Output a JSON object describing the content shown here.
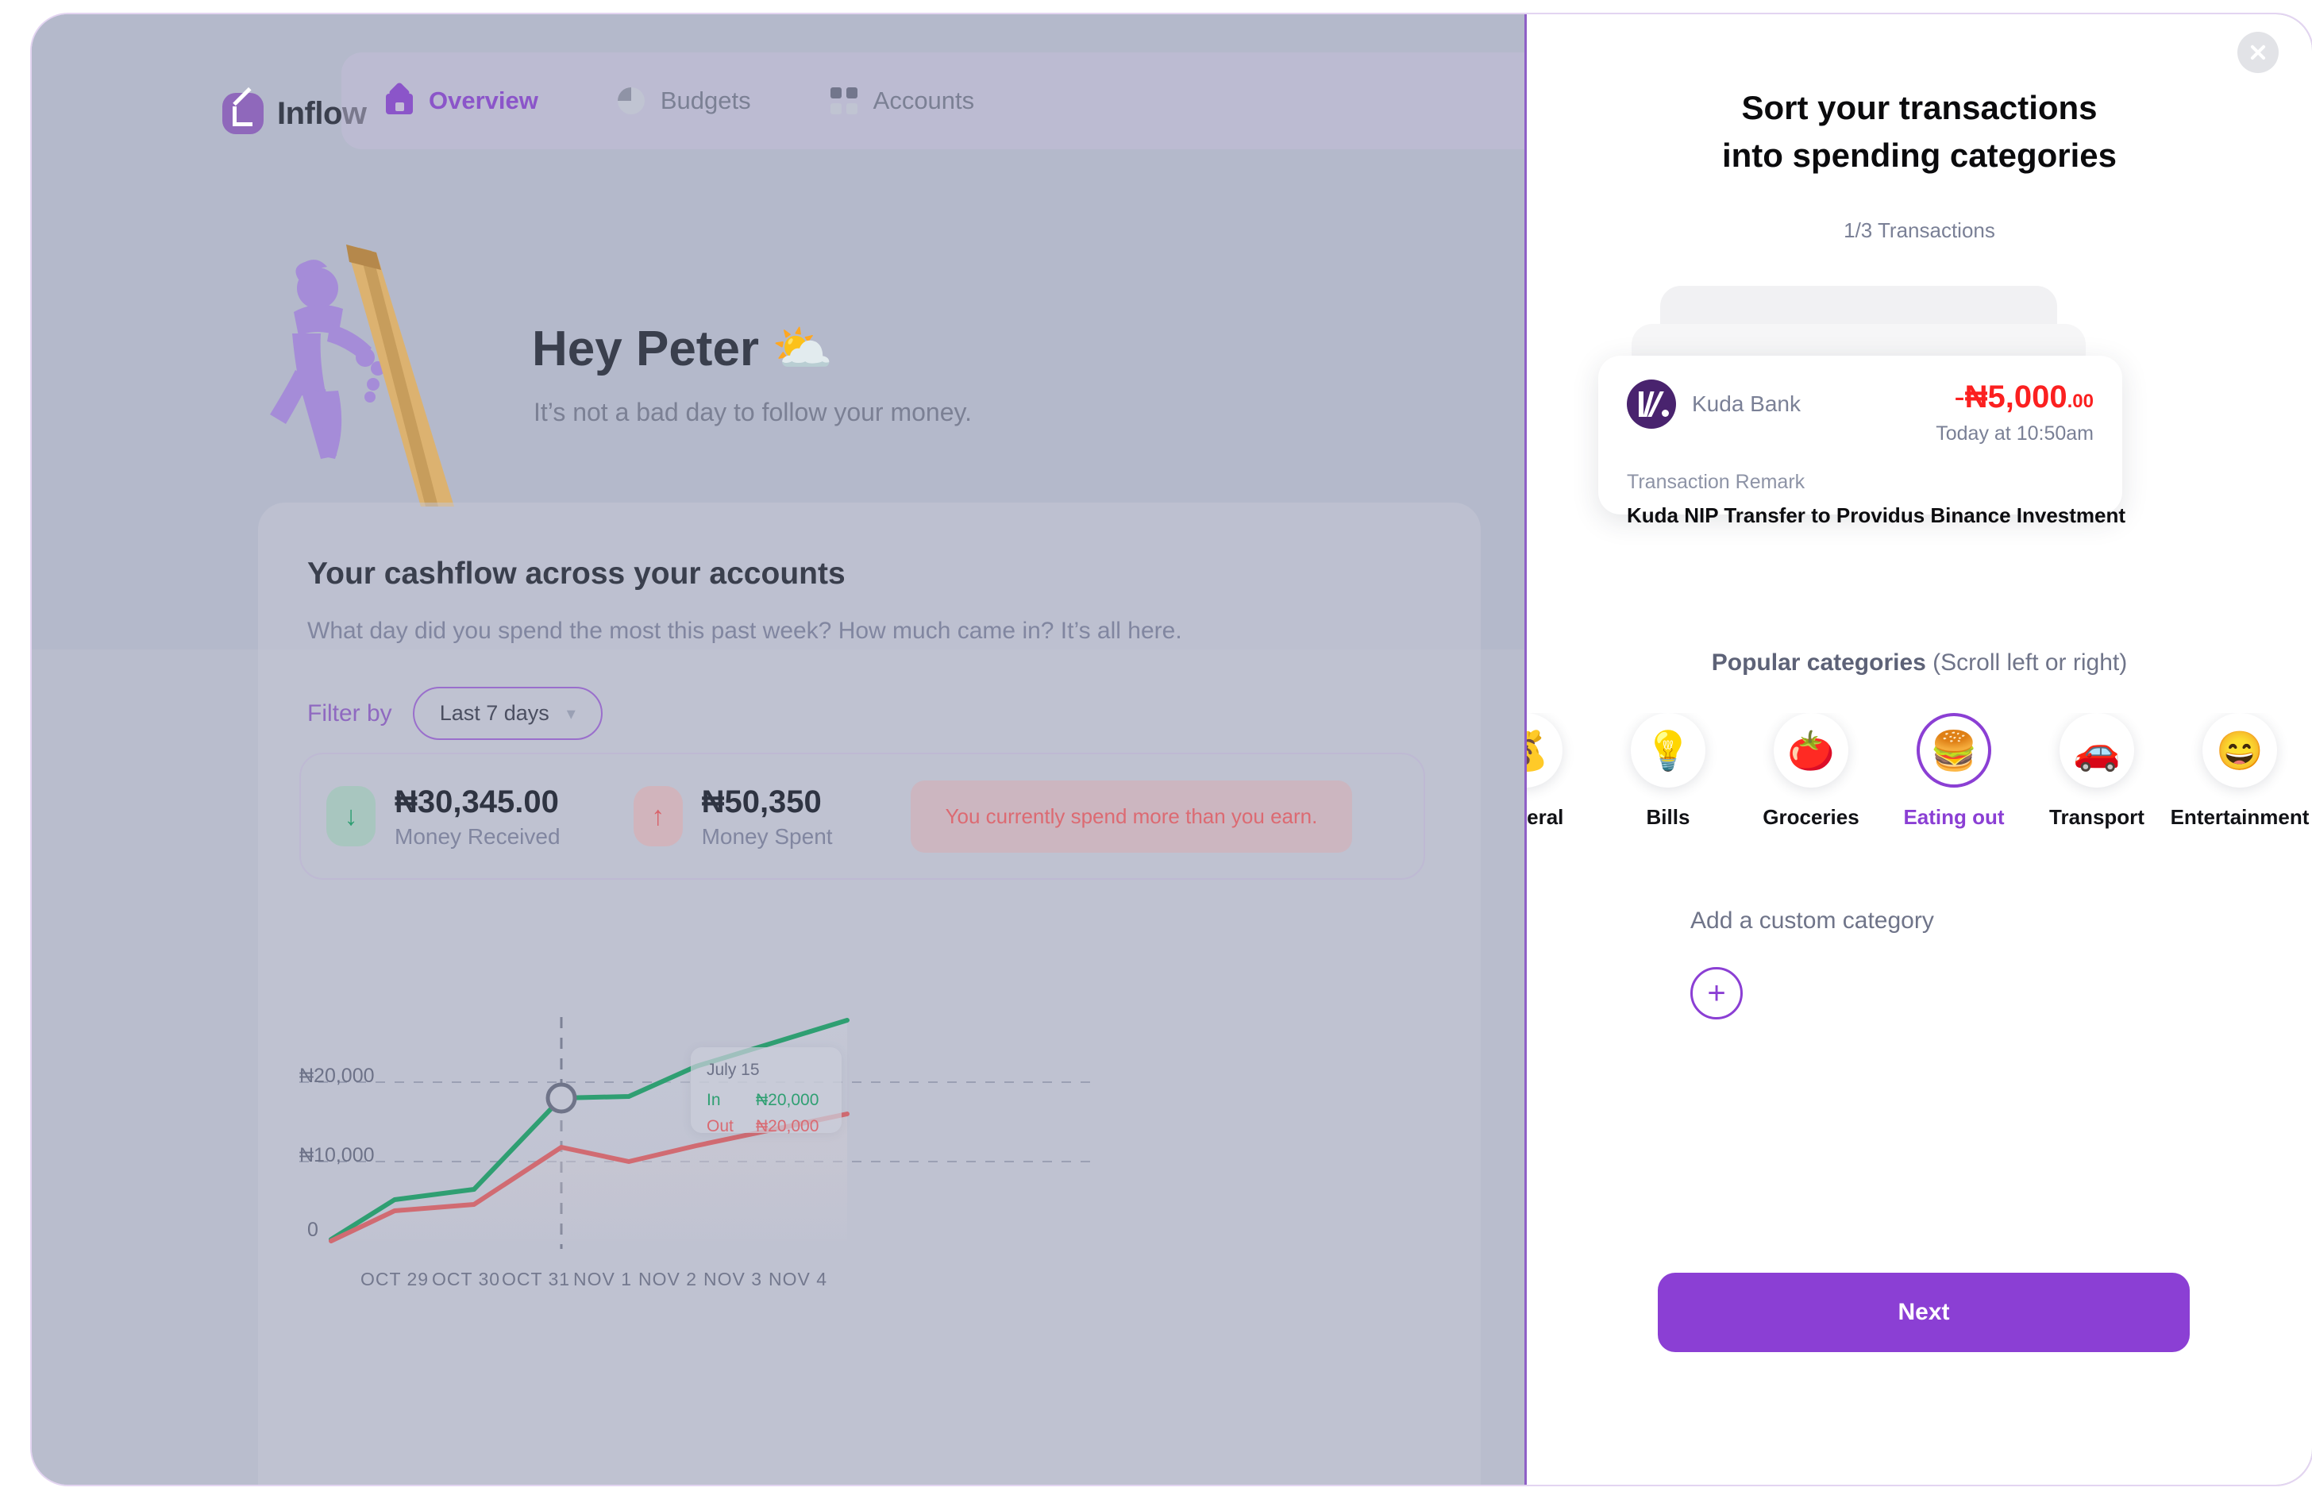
{
  "app": {
    "brand": "Inflow",
    "nav": [
      {
        "label": "Overview",
        "icon": "home-icon",
        "active": true
      },
      {
        "label": "Budgets",
        "icon": "pie-chart-icon",
        "active": false
      },
      {
        "label": "Accounts",
        "icon": "grid-icon",
        "active": false
      }
    ]
  },
  "hero": {
    "title": "Hey Peter",
    "emoji": "⛅",
    "subtitle": "It’s not a bad day to follow your money."
  },
  "cashflow": {
    "title": "Your cashflow across your accounts",
    "subtitle": "What day did you spend the most this past week? How much came in? It’s all here.",
    "filter_label": "Filter by",
    "filter_value": "Last 7 days",
    "filter_options": [
      "Last 7 days"
    ],
    "received": {
      "value": "₦30,345.00",
      "caption": "Money Received",
      "arrow": "↓"
    },
    "spent": {
      "value": "₦50,350",
      "caption": "Money Spent",
      "arrow": "↑"
    },
    "warning": "You currently spend more than you earn."
  },
  "chart_data": {
    "type": "line",
    "title": "Your cashflow across your accounts",
    "xlabel": "",
    "ylabel": "",
    "categories": [
      "OCT 29",
      "OCT 30",
      "OCT 31",
      "NOV 1",
      "NOV 2",
      "NOV 3",
      "NOV 4"
    ],
    "ytick_labels": [
      "0",
      "₦10,000",
      "₦20,000"
    ],
    "ytick_values": [
      0,
      10000,
      20000
    ],
    "ylim": [
      0,
      26000
    ],
    "grid": "horizontal-dashed",
    "legend": "none",
    "series": [
      {
        "name": "In",
        "color": "#2f9f72",
        "values": [
          0,
          4200,
          5300,
          15200,
          15300,
          17200,
          25000
        ]
      },
      {
        "name": "Out",
        "color": "#d16b72",
        "values": [
          0,
          3200,
          3900,
          11200,
          9500,
          11000,
          15500
        ]
      }
    ],
    "cursor": {
      "x_index": 3,
      "x_label": "NOV 1"
    },
    "tooltip": {
      "date": "July 15",
      "rows": [
        {
          "key": "In",
          "value": "₦20,000",
          "color": "#2f9f72"
        },
        {
          "key": "Out",
          "value": "₦20,000",
          "color": "#d96a72"
        }
      ]
    }
  },
  "panel": {
    "title_line1": "Sort your transactions",
    "title_line2": "into spending categories",
    "progress": "1/3 Transactions",
    "close_icon": "close-icon",
    "transaction": {
      "bank": "Kuda Bank",
      "amount_sign": "-",
      "amount_main": "₦5,000",
      "amount_decimals": ".00",
      "amount_color": "#fb2020",
      "time": "Today at 10:50am",
      "remark_label": "Transaction Remark",
      "remark": "Kuda NIP Transfer to Providus Binance Investment"
    },
    "categories_heading_bold": "Popular categories",
    "categories_heading_rest": " (Scroll left or right)",
    "categories": [
      {
        "label": "General",
        "emoji": "💰",
        "selected": false
      },
      {
        "label": "Bills",
        "emoji": "💡",
        "selected": false
      },
      {
        "label": "Groceries",
        "emoji": "🍅",
        "selected": false
      },
      {
        "label": "Eating out",
        "emoji": "🍔",
        "selected": true
      },
      {
        "label": "Transport",
        "emoji": "🚗",
        "selected": false
      },
      {
        "label": "Entertainment",
        "emoji": "😄",
        "selected": false
      }
    ],
    "selected_check": "✓",
    "add_custom_label": "Add a custom category",
    "add_custom_icon": "plus-icon",
    "next_label": "Next",
    "accent": "#8b3fd4"
  }
}
